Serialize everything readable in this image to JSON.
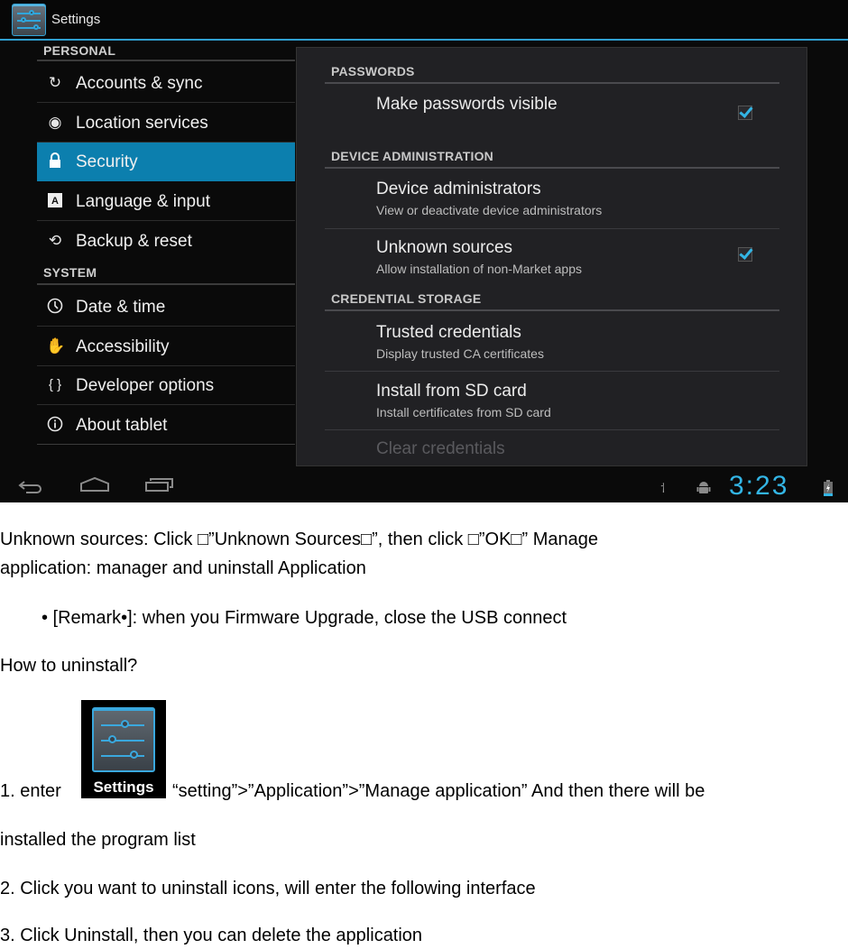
{
  "screenshot": {
    "action_bar": {
      "title": "Settings",
      "icon": "settings-sliders-icon"
    },
    "nav": {
      "sections": [
        {
          "header": "PERSONAL",
          "items": [
            {
              "label": "Accounts & sync",
              "icon": "sync-icon",
              "active": false
            },
            {
              "label": "Location services",
              "icon": "location-icon",
              "active": false
            },
            {
              "label": "Security",
              "icon": "lock-icon",
              "active": true
            },
            {
              "label": "Language & input",
              "icon": "keyboard-a-icon",
              "active": false
            },
            {
              "label": "Backup & reset",
              "icon": "backup-icon",
              "active": false
            }
          ]
        },
        {
          "header": "SYSTEM",
          "items": [
            {
              "label": "Date & time",
              "icon": "clock-icon",
              "active": false
            },
            {
              "label": "Accessibility",
              "icon": "hand-icon",
              "active": false
            },
            {
              "label": "Developer options",
              "icon": "braces-icon",
              "active": false
            },
            {
              "label": "About tablet",
              "icon": "info-icon",
              "active": false
            }
          ]
        }
      ]
    },
    "detail": {
      "sections": [
        {
          "header": "PASSWORDS",
          "items": [
            {
              "title": "Make passwords visible",
              "summary": "",
              "checked": true
            }
          ]
        },
        {
          "header": "DEVICE ADMINISTRATION",
          "items": [
            {
              "title": "Device administrators",
              "summary": "View or deactivate device administrators"
            },
            {
              "title": "Unknown sources",
              "summary": "Allow installation of non-Market apps",
              "checked": true
            }
          ]
        },
        {
          "header": "CREDENTIAL STORAGE",
          "items": [
            {
              "title": "Trusted credentials",
              "summary": "Display trusted CA certificates"
            },
            {
              "title": "Install from SD card",
              "summary": "Install certificates from SD card"
            },
            {
              "title": "Clear credentials",
              "summary": "",
              "disabled": true
            }
          ]
        }
      ]
    },
    "system_bar": {
      "nav_buttons": [
        "back-icon",
        "home-icon",
        "recent-apps-icon"
      ],
      "status_icons": [
        "usb-icon",
        "android-debug-icon",
        "battery-charging-icon"
      ],
      "clock": "3:23",
      "accent_color": "#33b5e5"
    }
  },
  "document": {
    "line1": "Unknown sources: Click □”Unknown Sources□”, then click □”OK□” Manage",
    "line2": "application: manager and uninstall Application",
    "remark": "• [Remark•]:  when you Firmware Upgrade, close the USB connect",
    "how_to": "How to uninstall?",
    "step1_prefix": "1. enter",
    "step1_icon_caption": "Settings",
    "step1_suffix": "“setting”>”Application”>”Manage application” And then there will be",
    "step1_cont": "installed the program list",
    "step2": "2. Click you want to uninstall icons, will enter the following interface",
    "step3": "3. Click Uninstall, then you can delete the application"
  }
}
